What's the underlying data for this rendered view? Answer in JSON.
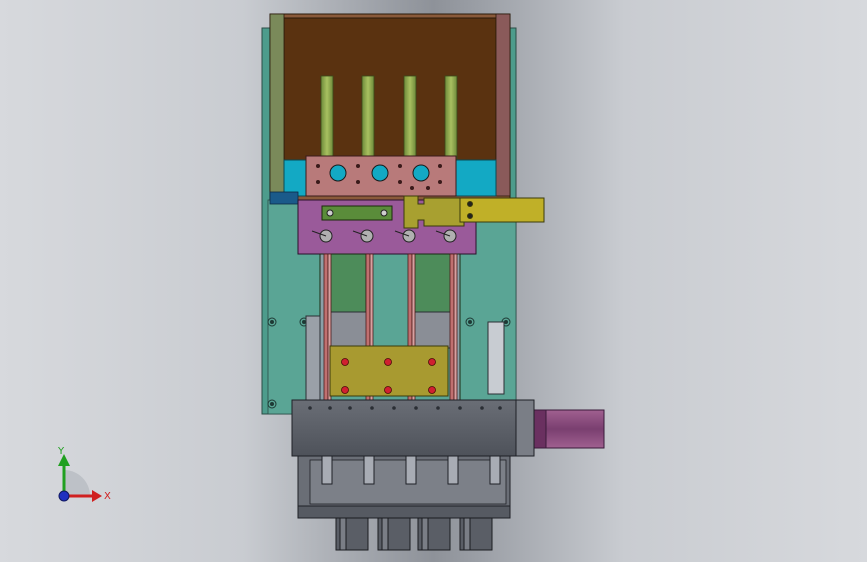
{
  "axes": {
    "x_label": "X",
    "y_label": "Y"
  },
  "colors": {
    "background_edge": "#d7d9dd",
    "background_center": "#8e9299",
    "hopper": "#5a3210",
    "hopper_right_band": "#8a5a3a",
    "cyan_block": "#13a9c4",
    "teal_plate": "#4d9c8c",
    "green_rail": "#5a8c3a",
    "pink_block": "#b87a7a",
    "magenta_block": "#9a5a9a",
    "olive": "#a8a030",
    "grey_body": "#5c6068",
    "purple_cylinder": "#8a4f7f",
    "x_axis": "#d02020",
    "y_axis": "#20a020",
    "z_axis": "#2030c0"
  }
}
